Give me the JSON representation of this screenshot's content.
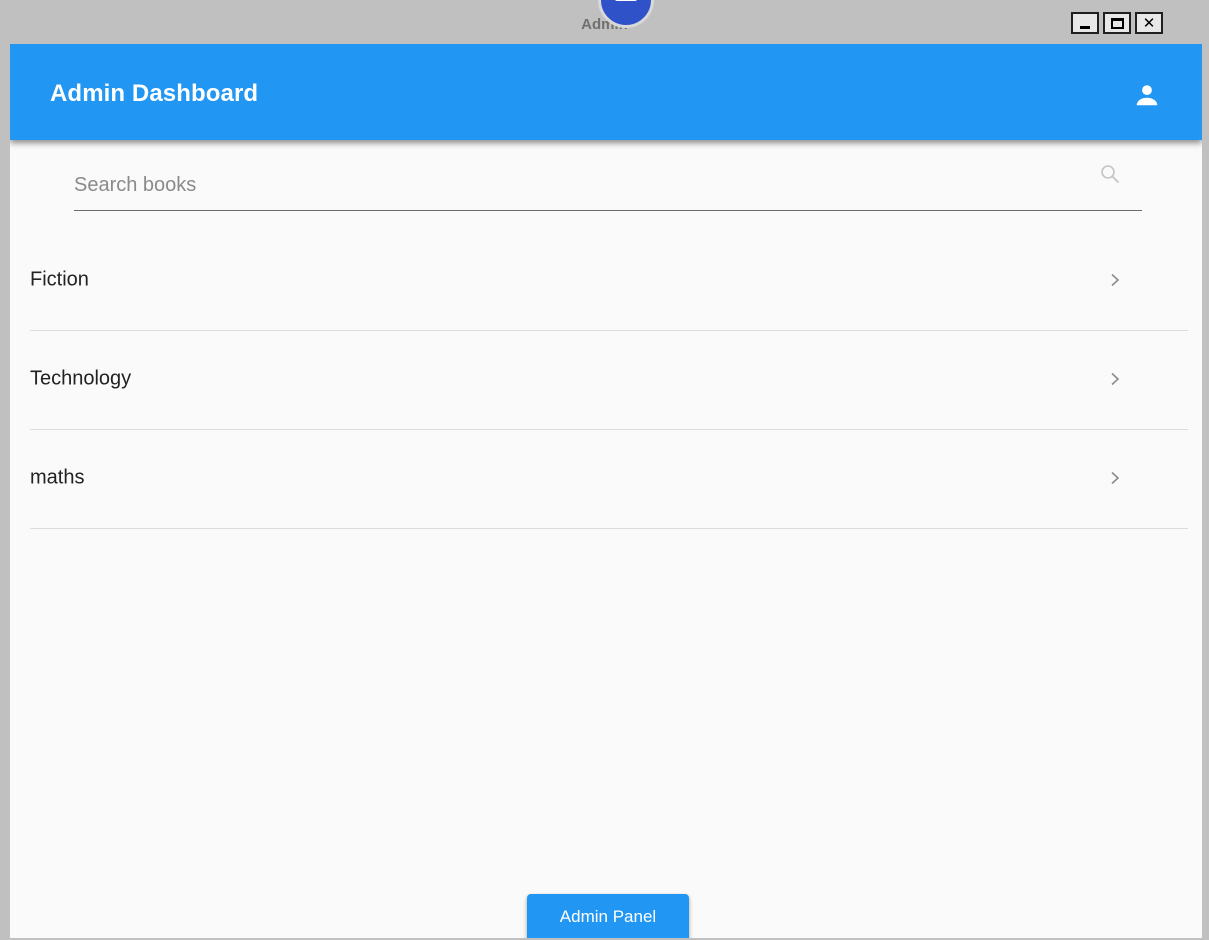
{
  "window": {
    "title": "Admin",
    "controls": {
      "minimize": "minimize-icon",
      "maximize": "maximize-icon",
      "close": "close-icon"
    }
  },
  "appbar": {
    "title": "Admin Dashboard",
    "account_icon": "account-icon",
    "color": "#2196f3"
  },
  "search": {
    "placeholder": "Search books",
    "value": "",
    "icon": "search-icon"
  },
  "categories": [
    {
      "label": "Fiction",
      "icon": "chevron-right-icon"
    },
    {
      "label": "Technology",
      "icon": "chevron-right-icon"
    },
    {
      "label": "maths",
      "icon": "chevron-right-icon"
    }
  ],
  "admin_button": {
    "label": "Admin Panel"
  }
}
